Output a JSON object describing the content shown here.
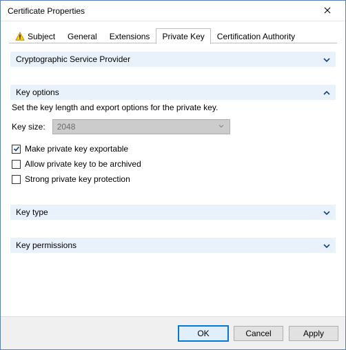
{
  "window": {
    "title": "Certificate Properties"
  },
  "tabs": {
    "subject": {
      "label": "Subject"
    },
    "general": {
      "label": "General"
    },
    "ext": {
      "label": "Extensions"
    },
    "pkey": {
      "label": "Private Key"
    },
    "ca": {
      "label": "Certification Authority"
    }
  },
  "sections": {
    "csp": {
      "title": "Cryptographic Service Provider"
    },
    "opts": {
      "title": "Key options",
      "desc": "Set the key length and export options for the private key.",
      "keysize_label": "Key size:",
      "keysize_value": "2048",
      "cb_exportable": "Make private key exportable",
      "cb_archive": "Allow private key to be archived",
      "cb_strong": "Strong private key protection"
    },
    "type": {
      "title": "Key type"
    },
    "perm": {
      "title": "Key permissions"
    }
  },
  "colors": {
    "section_bg": "#e9f2fb",
    "chevron": "#0b3e91"
  },
  "buttons": {
    "ok": "OK",
    "cancel": "Cancel",
    "apply": "Apply"
  }
}
